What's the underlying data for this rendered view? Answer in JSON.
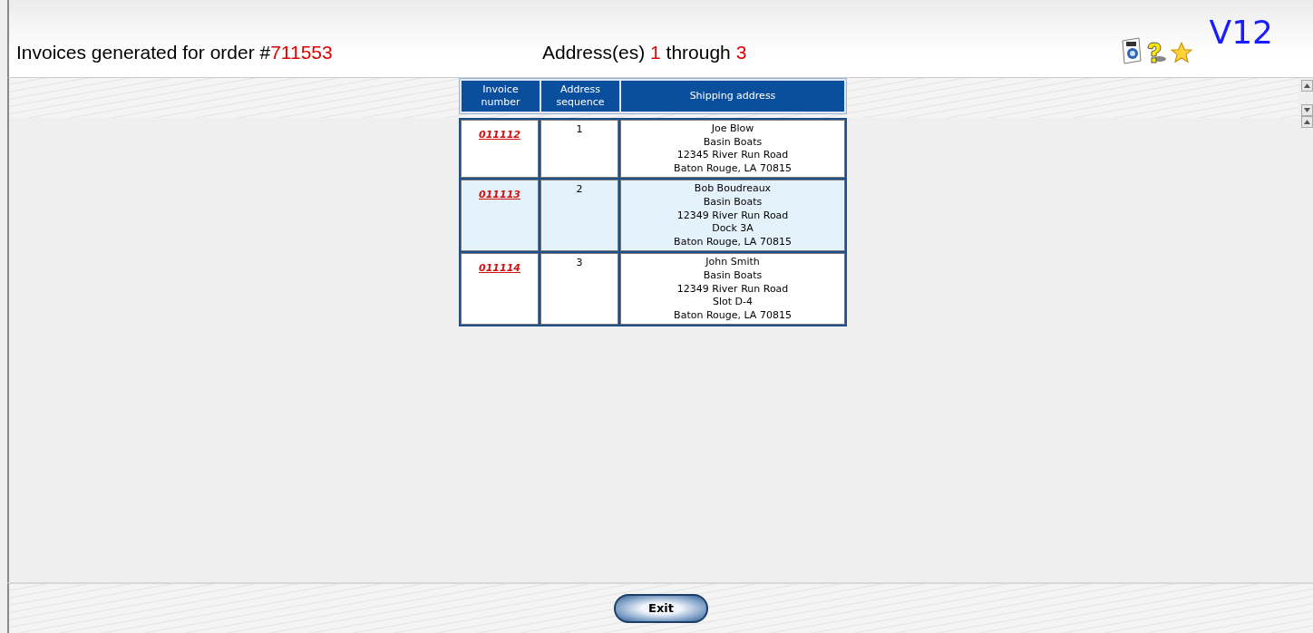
{
  "header": {
    "title": {
      "text": "Invoices generated for order #",
      "order": "711553"
    },
    "range": {
      "prefix": "Address(es)",
      "from": "1",
      "middle": "through",
      "to": "3"
    },
    "version": "V12"
  },
  "table": {
    "columns": [
      {
        "label": "Invoice number"
      },
      {
        "label": "Address sequence"
      },
      {
        "label": "Shipping address"
      }
    ],
    "rows": [
      {
        "invoice": "011112",
        "sequence": "1",
        "shaded": false,
        "address": [
          "Joe Blow",
          "Basin Boats",
          "12345 River Run Road",
          "Baton Rouge, LA 70815"
        ]
      },
      {
        "invoice": "011113",
        "sequence": "2",
        "shaded": true,
        "address": [
          "Bob Boudreaux",
          "Basin Boats",
          "12349 River Run Road",
          "Dock 3A",
          "Baton Rouge, LA 70815"
        ]
      },
      {
        "invoice": "011114",
        "sequence": "3",
        "shaded": false,
        "address": [
          "John Smith",
          "Basin Boats",
          "12349 River Run Road",
          "Slot D-4",
          "Baton Rouge, LA 70815"
        ]
      }
    ]
  },
  "footer": {
    "button": "Exit"
  }
}
